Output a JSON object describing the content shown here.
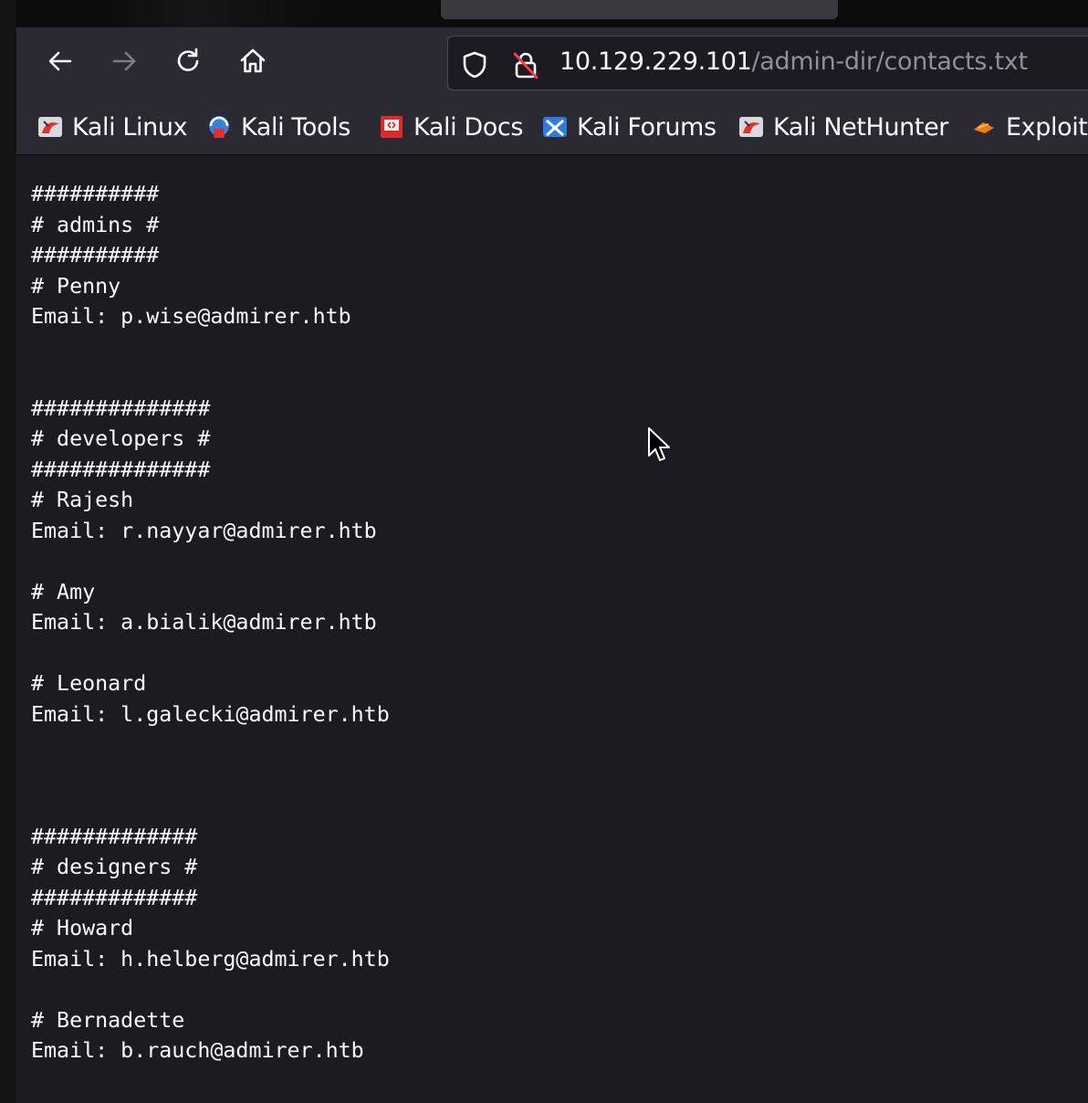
{
  "browser": {
    "nav": {
      "back": "back-arrow-icon",
      "forward": "forward-arrow-icon",
      "reload": "reload-icon",
      "home": "home-icon"
    },
    "url": {
      "host": "10.129.229.101",
      "path": "/admin-dir/contacts.txt",
      "shield_icon": "shield-icon",
      "lock_icon": "insecure-lock-icon"
    },
    "bookmarks": [
      {
        "label": "Kali Linux",
        "icon": "kali-dragon-icon"
      },
      {
        "label": "Kali Tools",
        "icon": "kali-tools-icon"
      },
      {
        "label": "Kali Docs",
        "icon": "kali-docs-icon"
      },
      {
        "label": "Kali Forums",
        "icon": "kali-forums-icon"
      },
      {
        "label": "Kali NetHunter",
        "icon": "kali-dragon-icon"
      },
      {
        "label": "Exploit",
        "icon": "exploit-db-icon"
      }
    ]
  },
  "document": {
    "lines": [
      "##########",
      "# admins #",
      "##########",
      "# Penny",
      "Email: p.wise@admirer.htb",
      "",
      "",
      "##############",
      "# developers #",
      "##############",
      "# Rajesh",
      "Email: r.nayyar@admirer.htb",
      "",
      "# Amy",
      "Email: a.bialik@admirer.htb",
      "",
      "# Leonard",
      "Email: l.galecki@admirer.htb",
      "",
      "",
      "",
      "#############",
      "# designers #",
      "#############",
      "# Howard",
      "Email: h.helberg@admirer.htb",
      "",
      "# Bernadette",
      "Email: b.rauch@admirer.htb"
    ]
  },
  "colors": {
    "toolbar_bg": "#2b2a33",
    "content_bg": "#1c1b22",
    "text": "#fbfbfe",
    "url_path": "#8f8f9d"
  }
}
